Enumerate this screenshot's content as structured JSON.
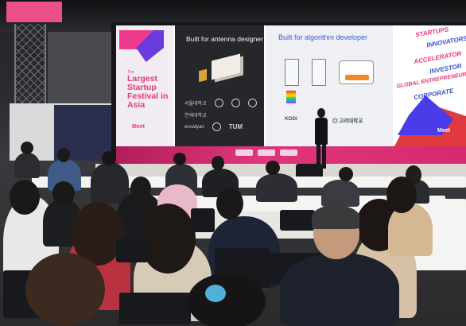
{
  "scene": {
    "description_alt": "",
    "screen": {
      "brand_panel": {
        "small_text": "The",
        "tagline": "Largest Startup Festival in Asia",
        "logo": "Meet"
      },
      "antenna_panel": {
        "title": "Built for antenna designer",
        "logos_row1": [
          "서울대학교",
          "◎",
          "S",
          "✿"
        ],
        "logos_row2": [
          "연세대학교",
          "",
          "",
          ""
        ],
        "logos_row3": [
          "ercodyan",
          "◎",
          "TUM"
        ]
      },
      "algorithm_panel": {
        "title": "Built for algorithm developer",
        "logos": [
          "KDDI",
          "◎ 고려대학교"
        ]
      },
      "words_panel": {
        "words": [
          {
            "text": "STARTUPS",
            "color": "#e8387f"
          },
          {
            "text": "INNOVATORS",
            "color": "#3a4fd8"
          },
          {
            "text": "ACCELERATOR",
            "color": "#e8387f"
          },
          {
            "text": "INVESTOR",
            "color": "#3a4fd8"
          },
          {
            "text": "GLOBAL ENTREPRENEUR",
            "color": "#e8387f"
          },
          {
            "text": "CORPORATE",
            "color": "#3a4fd8"
          }
        ],
        "logo": "Meet"
      }
    },
    "colors": {
      "brand_pink": "#e8387f",
      "brand_purple": "#4a3ce8",
      "stage_pink": "#d52b6e"
    }
  }
}
